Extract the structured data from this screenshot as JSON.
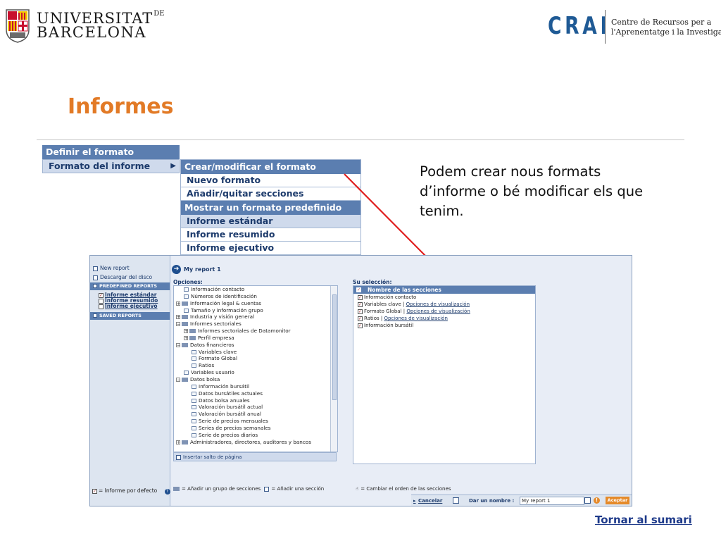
{
  "header": {
    "ub_line1": "UNIVERSITAT",
    "ub_line1_small": "DE",
    "ub_line2": "BARCELONA",
    "crai_logo": "CRAI",
    "crai_sub1": "Centre de Recursos per a",
    "crai_sub2": "l'Aprenentatge i la Investigació"
  },
  "title": "Informes",
  "menu1": {
    "header": "Definir el formato",
    "selected": "Formato del informe"
  },
  "menu2": {
    "header1": "Crear/modificar el formato",
    "items1": [
      "Nuevo formato",
      "Añadir/quitar secciones"
    ],
    "header2": "Mostrar un formato predefinido",
    "items2": [
      "Informe estándar",
      "Informe resumido",
      "Informe ejecutivo"
    ]
  },
  "note": "Podem crear nous formats d’informe o bé modificar els que tenim.",
  "shot": {
    "left": {
      "new_report": "New report",
      "download": "Descargar del disco",
      "predefined": "PREDEFINED REPORTS",
      "links": [
        "Informe estándar",
        "Informe resumido",
        "Informe ejecutivo"
      ],
      "saved": "SAVED REPORTS",
      "default_legend": "= Informe por defecto"
    },
    "report_title": "My report 1",
    "options_label": "Opciones:",
    "selection_label": "Su selección:",
    "tree": [
      {
        "t": "Información contacto",
        "lvl": 1,
        "k": "doc"
      },
      {
        "t": "Números de identificación",
        "lvl": 1,
        "k": "doc"
      },
      {
        "t": "Información legal & cuentas",
        "lvl": 0,
        "k": "fold"
      },
      {
        "t": "Tamaño y información grupo",
        "lvl": 1,
        "k": "doc"
      },
      {
        "t": "Industria y visión general",
        "lvl": 0,
        "k": "fold"
      },
      {
        "t": "Informes sectoriales",
        "lvl": 0,
        "k": "open"
      },
      {
        "t": "Informes sectoriales de Datamonitor",
        "lvl": 1,
        "k": "fold"
      },
      {
        "t": "Perfil empresa",
        "lvl": 1,
        "k": "fold"
      },
      {
        "t": "Datos financieros",
        "lvl": 0,
        "k": "open"
      },
      {
        "t": "Variables clave",
        "lvl": 2,
        "k": "doc"
      },
      {
        "t": "Formato Global",
        "lvl": 2,
        "k": "doc"
      },
      {
        "t": "Ratios",
        "lvl": 2,
        "k": "doc"
      },
      {
        "t": "Variables usuario",
        "lvl": 1,
        "k": "doc"
      },
      {
        "t": "Datos bolsa",
        "lvl": 0,
        "k": "open"
      },
      {
        "t": "Información bursátil",
        "lvl": 2,
        "k": "doc"
      },
      {
        "t": "Datos bursátiles actuales",
        "lvl": 2,
        "k": "doc"
      },
      {
        "t": "Datos bolsa anuales",
        "lvl": 2,
        "k": "doc"
      },
      {
        "t": "Valoración bursátil actual",
        "lvl": 2,
        "k": "doc"
      },
      {
        "t": "Valoración bursátil anual",
        "lvl": 2,
        "k": "doc"
      },
      {
        "t": "Serie de precios mensuales",
        "lvl": 2,
        "k": "doc"
      },
      {
        "t": "Series de precios semanales",
        "lvl": 2,
        "k": "doc"
      },
      {
        "t": "Serie de precios diarios",
        "lvl": 2,
        "k": "doc"
      },
      {
        "t": "Administradores, directores, auditores y bancos",
        "lvl": 0,
        "k": "fold"
      }
    ],
    "insert_page_break": "Insertar salto de página",
    "sel_header": "Nombre de las secciones",
    "sel_rows": [
      {
        "t": "Información contacto",
        "link": ""
      },
      {
        "t": "Variables clave | ",
        "link": "Opciones de visualización"
      },
      {
        "t": "Formato Global | ",
        "link": "Opciones de visualización"
      },
      {
        "t": "Ratios | ",
        "link": "Opciones de visualización"
      },
      {
        "t": "Información bursátil",
        "link": ""
      }
    ],
    "legend_group": "= Añadir un grupo de secciones",
    "legend_section": "= Añadir una sección",
    "legend_order": "= Cambiar el orden de las secciones",
    "cancel": "Cancelar",
    "name_label": "Dar un nombre :",
    "name_value": "My report 1",
    "accept": "Aceptar"
  },
  "back_link": "Tornar al sumari",
  "colors": {
    "accent": "#e27a26",
    "menu_blue": "#5b7eb0",
    "link": "#1e3a8a",
    "arrow": "#e02020"
  }
}
